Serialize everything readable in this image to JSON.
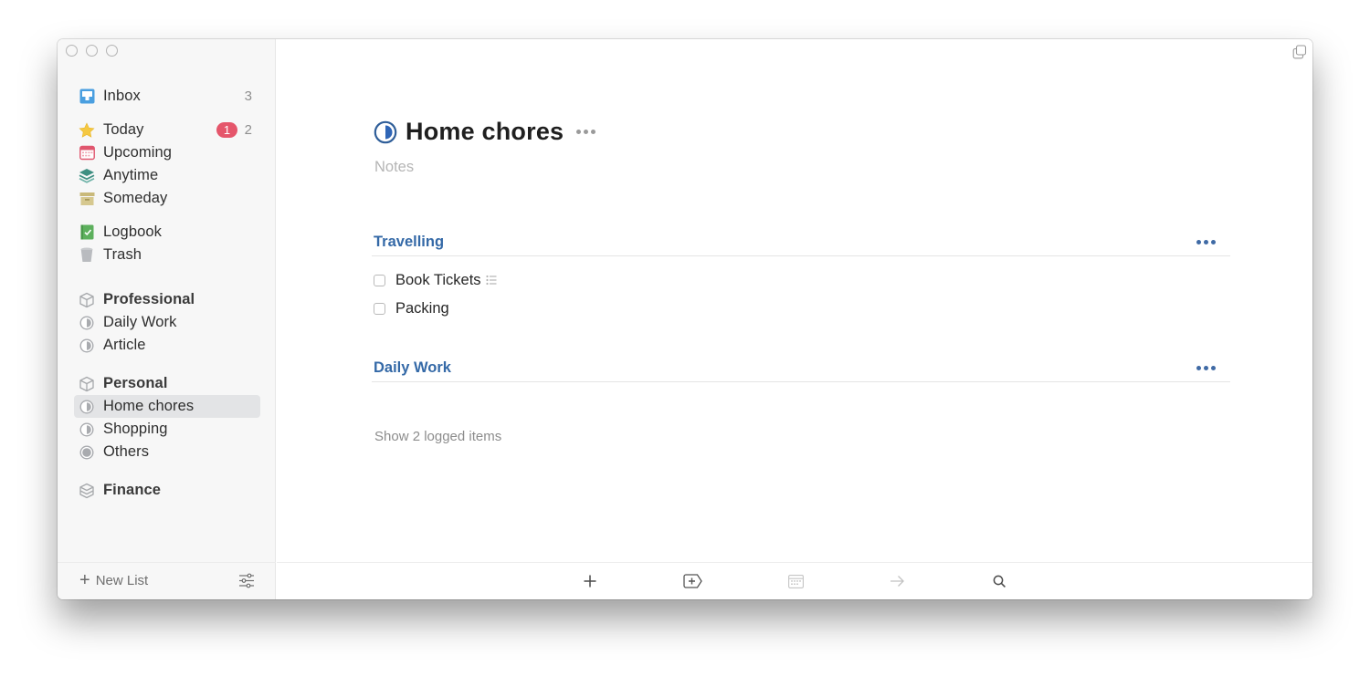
{
  "window": {
    "title": "Home chores"
  },
  "sidebar": {
    "inbox": {
      "label": "Inbox",
      "count": "3",
      "icon": "inbox-icon",
      "color": "#4a9fe0"
    },
    "smart_lists": [
      {
        "label": "Today",
        "badge": "1",
        "count": "2",
        "icon": "star-icon",
        "color": "#f5c842"
      },
      {
        "label": "Upcoming",
        "icon": "calendar-icon",
        "color": "#e0566e"
      },
      {
        "label": "Anytime",
        "icon": "layers-icon",
        "color": "#3f8f82"
      },
      {
        "label": "Someday",
        "icon": "archive-box-icon",
        "color": "#c9b97a"
      }
    ],
    "logbook": {
      "label": "Logbook",
      "icon": "logbook-icon",
      "color": "#5db05d"
    },
    "trash": {
      "label": "Trash",
      "icon": "trash-icon",
      "color": "#b9bbbf"
    },
    "areas": [
      {
        "label": "Professional",
        "projects": [
          {
            "label": "Daily Work"
          },
          {
            "label": "Article"
          }
        ]
      },
      {
        "label": "Personal",
        "projects": [
          {
            "label": "Home chores",
            "selected": true
          },
          {
            "label": "Shopping"
          },
          {
            "label": "Others"
          }
        ]
      },
      {
        "label": "Finance",
        "projects": []
      }
    ],
    "footer": {
      "new_list_label": "New List",
      "plus_glyph": "+"
    }
  },
  "project": {
    "title": "Home chores",
    "notes_placeholder": "Notes",
    "accent_color": "#3469a7",
    "headings": [
      {
        "title": "Travelling",
        "todos": [
          {
            "text": "Book Tickets",
            "has_checklist": true,
            "checked": false
          },
          {
            "text": "Packing",
            "has_checklist": false,
            "checked": false
          }
        ]
      },
      {
        "title": "Daily Work",
        "todos": []
      }
    ],
    "show_logged_label": "Show 2 logged items"
  },
  "toolbar": {
    "buttons": [
      {
        "name": "new-todo-button",
        "icon": "plus-icon"
      },
      {
        "name": "new-heading-button",
        "icon": "add-heading-icon"
      },
      {
        "name": "when-button",
        "icon": "calendar-icon"
      },
      {
        "name": "move-button",
        "icon": "arrow-right-icon"
      },
      {
        "name": "search-button",
        "icon": "search-icon"
      }
    ]
  },
  "colors": {
    "badge": "#e5566b",
    "heading": "#3469a7",
    "sidebar_bg": "#f7f7f7",
    "selected_bg": "#e3e4e6"
  }
}
